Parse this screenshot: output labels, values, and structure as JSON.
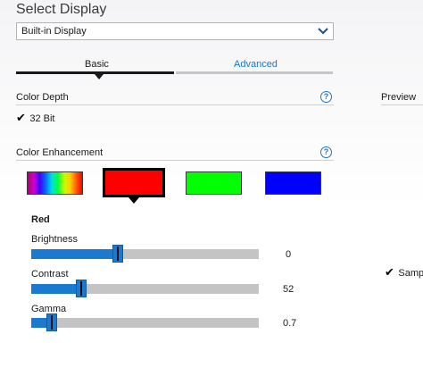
{
  "header": {
    "title": "Select Display",
    "display_select": {
      "value": "Built-in Display"
    }
  },
  "tabs": [
    {
      "label": "Basic",
      "active": true
    },
    {
      "label": "Advanced",
      "active": false
    }
  ],
  "color_depth": {
    "title": "Color Depth",
    "value": "32 Bit",
    "help": "?"
  },
  "color_enhancement": {
    "title": "Color Enhancement",
    "help": "?",
    "swatches": [
      {
        "name": "all",
        "selected": false
      },
      {
        "name": "red",
        "color": "#ff0000",
        "selected": true
      },
      {
        "name": "green",
        "color": "#00ff00",
        "selected": false
      },
      {
        "name": "blue",
        "color": "#0000ff",
        "selected": false
      }
    ]
  },
  "channel": {
    "title": "Red",
    "sliders": [
      {
        "label": "Brightness",
        "value": "0",
        "fraction": 0.38
      },
      {
        "label": "Contrast",
        "value": "52",
        "fraction": 0.22
      },
      {
        "label": "Gamma",
        "value": "0.7",
        "fraction": 0.09
      }
    ]
  },
  "preview": {
    "title": "Preview",
    "sample_label": "Sample"
  },
  "colors": {
    "accent": "#1877c8",
    "slider_fill": "#1a7ad0",
    "track": "#c4c4c4"
  }
}
